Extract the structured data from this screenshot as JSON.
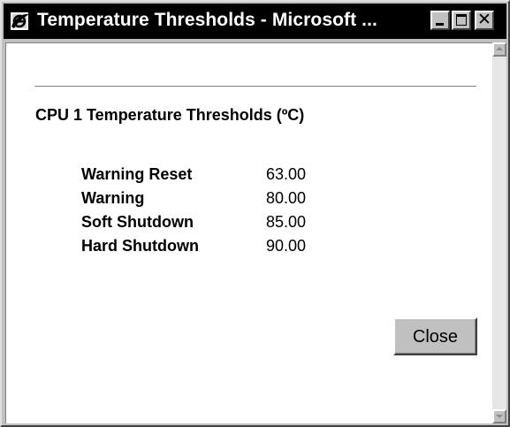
{
  "window": {
    "title": "Temperature Thresholds - Microsoft ...",
    "close_glyph": "✕"
  },
  "content": {
    "heading": "CPU 1 Temperature Thresholds (ºC)",
    "thresholds": [
      {
        "label": "Warning Reset",
        "value": "63.00"
      },
      {
        "label": "Warning",
        "value": "80.00"
      },
      {
        "label": "Soft Shutdown",
        "value": "85.00"
      },
      {
        "label": "Hard Shutdown",
        "value": "90.00"
      }
    ],
    "close_label": "Close"
  },
  "colors": {
    "titlebar": "#000000",
    "title_text": "#ffffff",
    "chrome": "#c0c0c0",
    "content_bg": "#ffffff"
  },
  "icons": {
    "app": "internet-explorer-icon",
    "minimize": "minimize-icon",
    "maximize": "maximize-icon",
    "close": "close-icon",
    "scroll_up": "scroll-up-arrow-icon",
    "scroll_down": "scroll-down-arrow-icon"
  }
}
